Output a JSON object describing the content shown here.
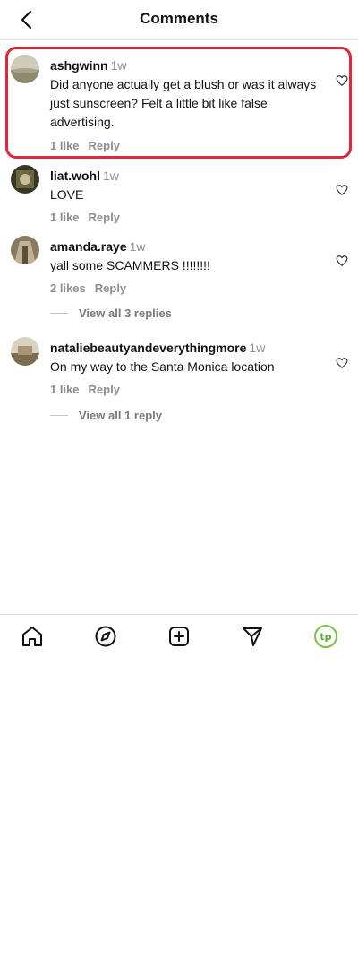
{
  "header": {
    "title": "Comments"
  },
  "comments": [
    {
      "username": "ashgwinn",
      "time": "1w",
      "text": "Did anyone actually get a blush or was it always just sunscreen? Felt a little bit like false advertising.",
      "likes": "1 like",
      "reply": "Reply"
    },
    {
      "username": "liat.wohl",
      "time": "1w",
      "text": "LOVE",
      "likes": "1 like",
      "reply": "Reply"
    },
    {
      "username": "amanda.raye",
      "time": "1w",
      "text": "yall some SCAMMERS !!!!!!!!",
      "likes": "2 likes",
      "reply": "Reply",
      "view_replies": "View all 3 replies"
    },
    {
      "username": "nataliebeautyandeverythingmore",
      "time": "1w",
      "text": "On my way to the Santa Monica location",
      "likes": "1 like",
      "reply": "Reply",
      "view_replies": "View all 1 reply"
    }
  ],
  "colors": {
    "highlight": "#e0283a",
    "profile_ring": "#7cc242"
  },
  "tabbar": {
    "items": [
      "home-icon",
      "explore-icon",
      "create-icon",
      "messages-icon",
      "profile-icon"
    ],
    "profile_initials": "tp"
  }
}
